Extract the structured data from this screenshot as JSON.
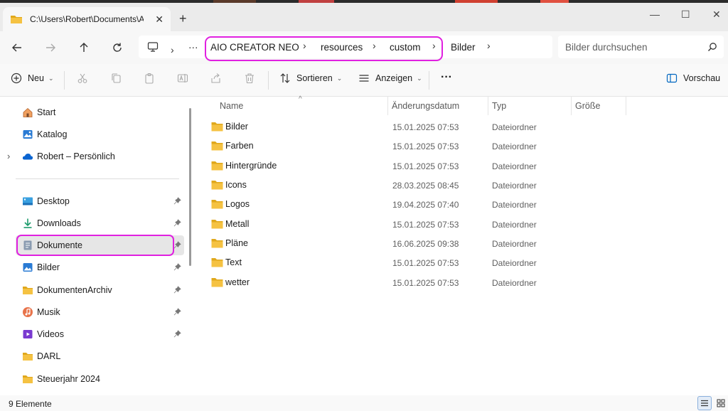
{
  "tab": {
    "title": "C:\\Users\\Robert\\Documents\\A",
    "close": "✕",
    "new": "+"
  },
  "window": {
    "minimize": "—",
    "maximize": "☐",
    "close": "✕"
  },
  "nav": {
    "more": "···",
    "breadcrumbs": [
      "AIO CREATOR NEO",
      "resources",
      "custom",
      "Bilder"
    ],
    "search_placeholder": "Bilder durchsuchen"
  },
  "commands": {
    "new_label": "Neu",
    "sort_label": "Sortieren",
    "view_label": "Anzeigen",
    "more": "···",
    "preview_label": "Vorschau"
  },
  "sidebar": {
    "top_items": [
      {
        "label": "Start"
      },
      {
        "label": "Katalog"
      },
      {
        "label": "Robert – Persönlich"
      }
    ],
    "quick_access": [
      {
        "label": "Desktop",
        "pinned": true
      },
      {
        "label": "Downloads",
        "pinned": true
      },
      {
        "label": "Dokumente",
        "pinned": true,
        "selected": true
      },
      {
        "label": "Bilder",
        "pinned": true
      },
      {
        "label": "DokumentenArchiv",
        "pinned": true
      },
      {
        "label": "Musik",
        "pinned": true
      },
      {
        "label": "Videos",
        "pinned": true
      },
      {
        "label": "DARL",
        "pinned": false
      },
      {
        "label": "Steuerjahr 2024",
        "pinned": false
      }
    ]
  },
  "columns": {
    "name": "Name",
    "date": "Änderungsdatum",
    "type": "Typ",
    "size": "Größe"
  },
  "files": [
    {
      "name": "Bilder",
      "date": "15.01.2025 07:53",
      "type": "Dateiordner"
    },
    {
      "name": "Farben",
      "date": "15.01.2025 07:53",
      "type": "Dateiordner"
    },
    {
      "name": "Hintergründe",
      "date": "15.01.2025 07:53",
      "type": "Dateiordner"
    },
    {
      "name": "Icons",
      "date": "28.03.2025 08:45",
      "type": "Dateiordner"
    },
    {
      "name": "Logos",
      "date": "19.04.2025 07:40",
      "type": "Dateiordner"
    },
    {
      "name": "Metall",
      "date": "15.01.2025 07:53",
      "type": "Dateiordner"
    },
    {
      "name": "Pläne",
      "date": "16.06.2025 09:38",
      "type": "Dateiordner"
    },
    {
      "name": "Text",
      "date": "15.01.2025 07:53",
      "type": "Dateiordner"
    },
    {
      "name": "wetter",
      "date": "15.01.2025 07:53",
      "type": "Dateiordner"
    }
  ],
  "status": {
    "count": "9 Elemente"
  },
  "colors": {
    "folder": "#f5c242",
    "folder_dark": "#e0a81c",
    "highlight": "#e020e0",
    "accent": "#0067c0"
  }
}
